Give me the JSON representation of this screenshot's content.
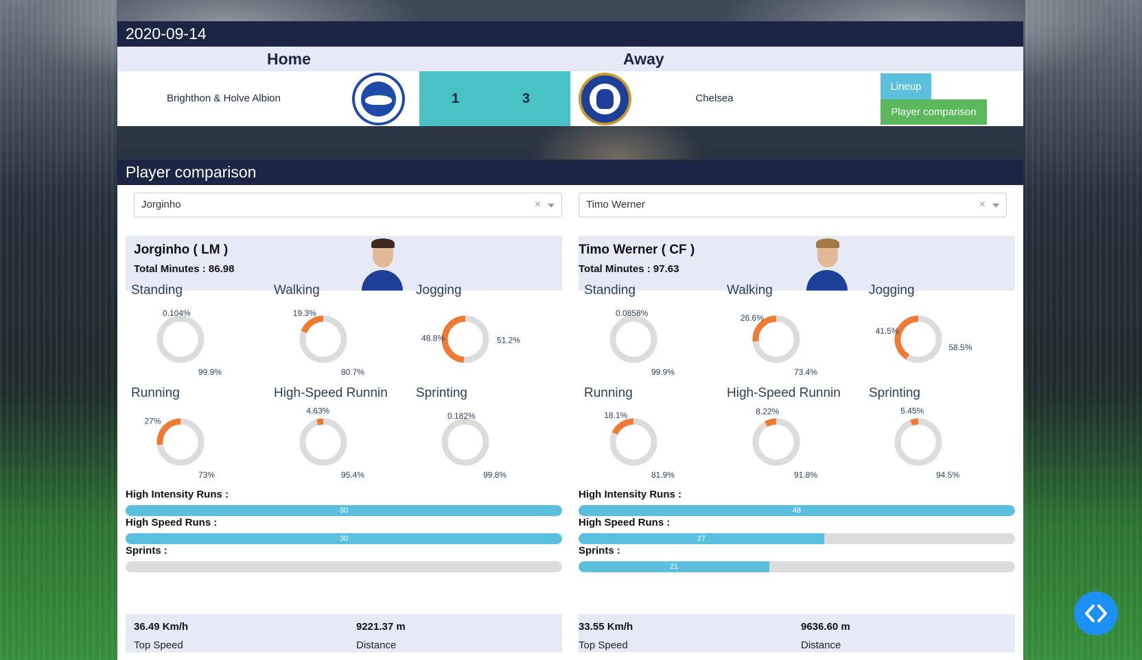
{
  "match": {
    "date": "2020-09-14",
    "home_label": "Home",
    "away_label": "Away",
    "home_team": "Brighthon & Holve Albion",
    "away_team": "Chelsea",
    "home_score": "1",
    "away_score": "3",
    "lineup_button": "Lineup",
    "player_comparison_button": "Player comparison"
  },
  "comparison": {
    "title": "Player comparison",
    "players": [
      {
        "selected": "Jorginho",
        "name": "Jorginho ( LM )",
        "total_minutes": "Total Minutes : 86.98",
        "donuts": [
          {
            "title": "Standing",
            "pct": 0.104,
            "label_a": "0.104%",
            "label_b": "99.9%"
          },
          {
            "title": "Walking",
            "pct": 19.3,
            "label_a": "19.3%",
            "label_b": "80.7%"
          },
          {
            "title": "Jogging",
            "pct": 48.8,
            "label_a": "48.8%",
            "label_b": "51.2%"
          },
          {
            "title": "Running",
            "pct": 27,
            "label_a": "27%",
            "label_b": "73%"
          },
          {
            "title": "High-Speed Runnin",
            "pct": 4.63,
            "label_a": "4.63%",
            "label_b": "95.4%"
          },
          {
            "title": "Sprinting",
            "pct": 0.182,
            "label_a": "0.182%",
            "label_b": "99.8%"
          }
        ],
        "metrics": [
          {
            "label": "High Intensity Runs :",
            "value": 30,
            "text": "30",
            "fill": 1.0
          },
          {
            "label": "High Speed Runs :",
            "value": 30,
            "text": "30",
            "fill": 1.0
          },
          {
            "label": "Sprints :",
            "value": 0,
            "text": "",
            "fill": 0
          }
        ],
        "top_speed": "36.49 Km/h",
        "top_speed_label": "Top Speed",
        "distance": "9221.37 m",
        "distance_label": "Distance"
      },
      {
        "selected": "Timo Werner",
        "name": "Timo Werner ( CF )",
        "total_minutes": "Total Minutes : 97.63",
        "donuts": [
          {
            "title": "Standing",
            "pct": 0.0858,
            "label_a": "0.0858%",
            "label_b": "99.9%"
          },
          {
            "title": "Walking",
            "pct": 26.6,
            "label_a": "26.6%",
            "label_b": "73.4%"
          },
          {
            "title": "Jogging",
            "pct": 41.5,
            "label_a": "41.5%",
            "label_b": "58.5%"
          },
          {
            "title": "Running",
            "pct": 18.1,
            "label_a": "18.1%",
            "label_b": "81.9%"
          },
          {
            "title": "High-Speed Runnin",
            "pct": 8.22,
            "label_a": "8.22%",
            "label_b": "91.8%"
          },
          {
            "title": "Sprinting",
            "pct": 5.45,
            "label_a": "5.45%",
            "label_b": "94.5%"
          }
        ],
        "metrics": [
          {
            "label": "High Intensity Runs :",
            "value": 48,
            "text": "48",
            "fill": 1.0
          },
          {
            "label": "High Speed Runs :",
            "value": 27,
            "text": "27",
            "fill": 0.5625
          },
          {
            "label": "Sprints :",
            "value": 21,
            "text": "21",
            "fill": 0.4375
          }
        ],
        "top_speed": "33.55 Km/h",
        "top_speed_label": "Top Speed",
        "distance": "9636.60 m",
        "distance_label": "Distance"
      }
    ]
  },
  "colors": {
    "header_bg": "#1b2544",
    "score_bg": "#48c2c5",
    "lineup_btn": "#5bc0de",
    "comparison_btn": "#5cb85c",
    "donut_primary": "#ee7a34",
    "donut_rest": "#dcdcdc",
    "bar_fill": "#5bc0de"
  },
  "icons": {
    "clear": "close-icon",
    "caret": "chevron-down-icon",
    "fab": "code-icon"
  }
}
